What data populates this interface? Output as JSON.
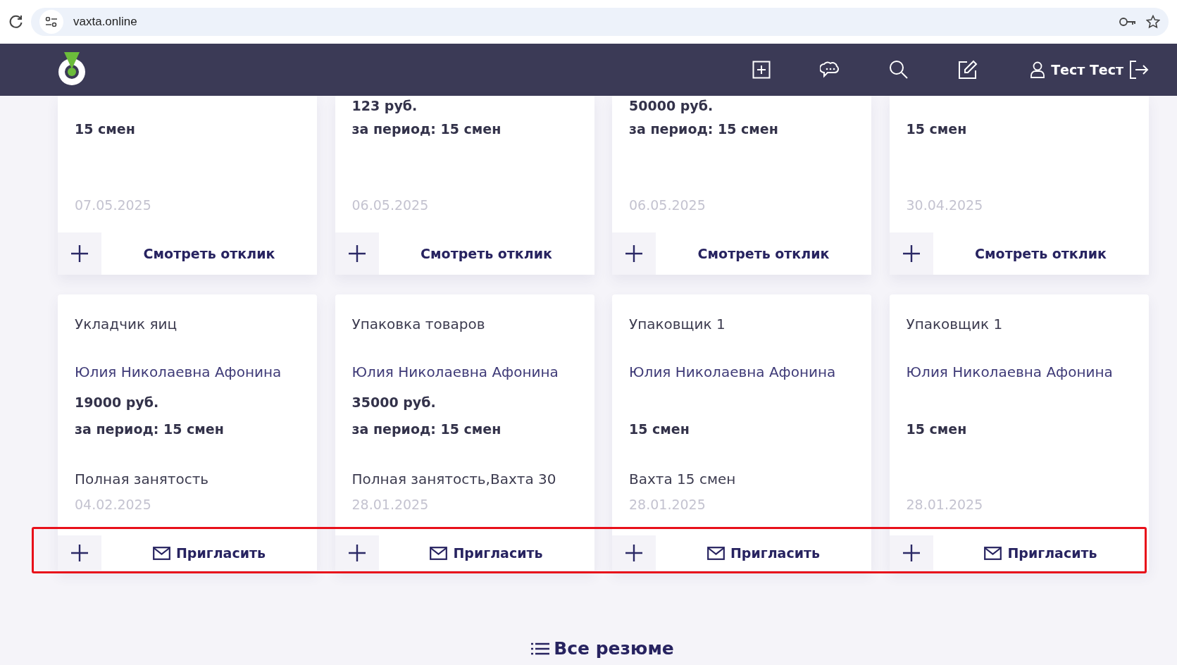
{
  "browser": {
    "url": "vaxta.online"
  },
  "header": {
    "user_name": "Тест Тест"
  },
  "top_cards": [
    {
      "period": "15 смен",
      "date": "07.05.2025",
      "action": "Смотреть отклик"
    },
    {
      "salary": "123 руб.",
      "period": "за период: 15 смен",
      "date": "06.05.2025",
      "action": "Смотреть отклик"
    },
    {
      "salary": "50000 руб.",
      "period": "за период: 15 смен",
      "date": "06.05.2025",
      "action": "Смотреть отклик"
    },
    {
      "period": "15 смен",
      "date": "30.04.2025",
      "action": "Смотреть отклик"
    }
  ],
  "resume_cards": [
    {
      "title": "Укладчик яиц",
      "author": "Юлия Николаевна Афонина",
      "salary": "19000 руб.",
      "period": "за период: 15 смен",
      "employment": "Полная занятость",
      "date": "04.02.2025",
      "action": "Пригласить"
    },
    {
      "title": "Упаковка товаров",
      "author": "Юлия Николаевна Афонина",
      "salary": "35000 руб.",
      "period": "за период: 15 смен",
      "employment": "Полная занятость,Вахта 30",
      "date": "28.01.2025",
      "action": "Пригласить"
    },
    {
      "title": "Упаковщик 1",
      "author": "Юлия Николаевна Афонина",
      "period": "15 смен",
      "employment": "Вахта 15 смен",
      "date": "28.01.2025",
      "action": "Пригласить"
    },
    {
      "title": "Упаковщик 1",
      "author": "Юлия Николаевна Афонина",
      "period": "15 смен",
      "date": "28.01.2025",
      "action": "Пригласить"
    }
  ],
  "all_resumes_link": "Все резюме"
}
